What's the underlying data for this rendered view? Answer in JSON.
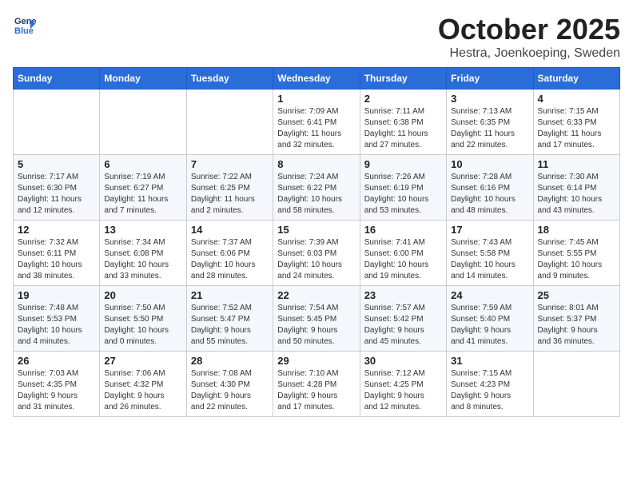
{
  "header": {
    "logo_line1": "General",
    "logo_line2": "Blue",
    "month": "October 2025",
    "location": "Hestra, Joenkoeping, Sweden"
  },
  "weekdays": [
    "Sunday",
    "Monday",
    "Tuesday",
    "Wednesday",
    "Thursday",
    "Friday",
    "Saturday"
  ],
  "weeks": [
    [
      {
        "day": "",
        "info": ""
      },
      {
        "day": "",
        "info": ""
      },
      {
        "day": "",
        "info": ""
      },
      {
        "day": "1",
        "info": "Sunrise: 7:09 AM\nSunset: 6:41 PM\nDaylight: 11 hours\nand 32 minutes."
      },
      {
        "day": "2",
        "info": "Sunrise: 7:11 AM\nSunset: 6:38 PM\nDaylight: 11 hours\nand 27 minutes."
      },
      {
        "day": "3",
        "info": "Sunrise: 7:13 AM\nSunset: 6:35 PM\nDaylight: 11 hours\nand 22 minutes."
      },
      {
        "day": "4",
        "info": "Sunrise: 7:15 AM\nSunset: 6:33 PM\nDaylight: 11 hours\nand 17 minutes."
      }
    ],
    [
      {
        "day": "5",
        "info": "Sunrise: 7:17 AM\nSunset: 6:30 PM\nDaylight: 11 hours\nand 12 minutes."
      },
      {
        "day": "6",
        "info": "Sunrise: 7:19 AM\nSunset: 6:27 PM\nDaylight: 11 hours\nand 7 minutes."
      },
      {
        "day": "7",
        "info": "Sunrise: 7:22 AM\nSunset: 6:25 PM\nDaylight: 11 hours\nand 2 minutes."
      },
      {
        "day": "8",
        "info": "Sunrise: 7:24 AM\nSunset: 6:22 PM\nDaylight: 10 hours\nand 58 minutes."
      },
      {
        "day": "9",
        "info": "Sunrise: 7:26 AM\nSunset: 6:19 PM\nDaylight: 10 hours\nand 53 minutes."
      },
      {
        "day": "10",
        "info": "Sunrise: 7:28 AM\nSunset: 6:16 PM\nDaylight: 10 hours\nand 48 minutes."
      },
      {
        "day": "11",
        "info": "Sunrise: 7:30 AM\nSunset: 6:14 PM\nDaylight: 10 hours\nand 43 minutes."
      }
    ],
    [
      {
        "day": "12",
        "info": "Sunrise: 7:32 AM\nSunset: 6:11 PM\nDaylight: 10 hours\nand 38 minutes."
      },
      {
        "day": "13",
        "info": "Sunrise: 7:34 AM\nSunset: 6:08 PM\nDaylight: 10 hours\nand 33 minutes."
      },
      {
        "day": "14",
        "info": "Sunrise: 7:37 AM\nSunset: 6:06 PM\nDaylight: 10 hours\nand 28 minutes."
      },
      {
        "day": "15",
        "info": "Sunrise: 7:39 AM\nSunset: 6:03 PM\nDaylight: 10 hours\nand 24 minutes."
      },
      {
        "day": "16",
        "info": "Sunrise: 7:41 AM\nSunset: 6:00 PM\nDaylight: 10 hours\nand 19 minutes."
      },
      {
        "day": "17",
        "info": "Sunrise: 7:43 AM\nSunset: 5:58 PM\nDaylight: 10 hours\nand 14 minutes."
      },
      {
        "day": "18",
        "info": "Sunrise: 7:45 AM\nSunset: 5:55 PM\nDaylight: 10 hours\nand 9 minutes."
      }
    ],
    [
      {
        "day": "19",
        "info": "Sunrise: 7:48 AM\nSunset: 5:53 PM\nDaylight: 10 hours\nand 4 minutes."
      },
      {
        "day": "20",
        "info": "Sunrise: 7:50 AM\nSunset: 5:50 PM\nDaylight: 10 hours\nand 0 minutes."
      },
      {
        "day": "21",
        "info": "Sunrise: 7:52 AM\nSunset: 5:47 PM\nDaylight: 9 hours\nand 55 minutes."
      },
      {
        "day": "22",
        "info": "Sunrise: 7:54 AM\nSunset: 5:45 PM\nDaylight: 9 hours\nand 50 minutes."
      },
      {
        "day": "23",
        "info": "Sunrise: 7:57 AM\nSunset: 5:42 PM\nDaylight: 9 hours\nand 45 minutes."
      },
      {
        "day": "24",
        "info": "Sunrise: 7:59 AM\nSunset: 5:40 PM\nDaylight: 9 hours\nand 41 minutes."
      },
      {
        "day": "25",
        "info": "Sunrise: 8:01 AM\nSunset: 5:37 PM\nDaylight: 9 hours\nand 36 minutes."
      }
    ],
    [
      {
        "day": "26",
        "info": "Sunrise: 7:03 AM\nSunset: 4:35 PM\nDaylight: 9 hours\nand 31 minutes."
      },
      {
        "day": "27",
        "info": "Sunrise: 7:06 AM\nSunset: 4:32 PM\nDaylight: 9 hours\nand 26 minutes."
      },
      {
        "day": "28",
        "info": "Sunrise: 7:08 AM\nSunset: 4:30 PM\nDaylight: 9 hours\nand 22 minutes."
      },
      {
        "day": "29",
        "info": "Sunrise: 7:10 AM\nSunset: 4:28 PM\nDaylight: 9 hours\nand 17 minutes."
      },
      {
        "day": "30",
        "info": "Sunrise: 7:12 AM\nSunset: 4:25 PM\nDaylight: 9 hours\nand 12 minutes."
      },
      {
        "day": "31",
        "info": "Sunrise: 7:15 AM\nSunset: 4:23 PM\nDaylight: 9 hours\nand 8 minutes."
      },
      {
        "day": "",
        "info": ""
      }
    ]
  ]
}
